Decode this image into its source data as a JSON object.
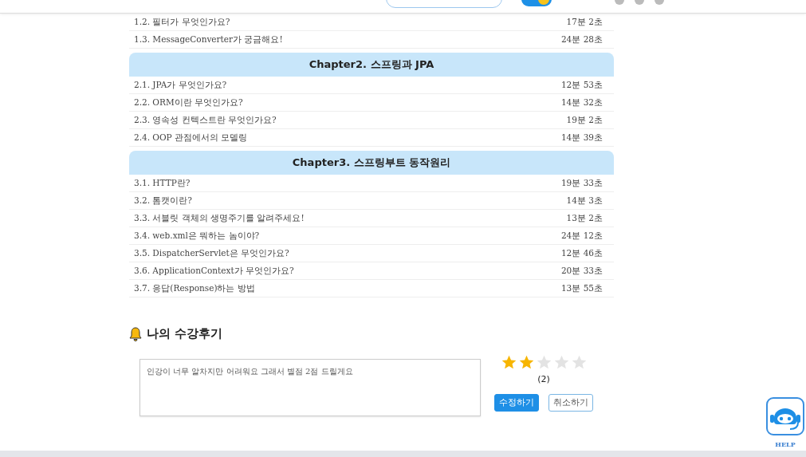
{
  "curriculum": [
    {
      "lessons": [
        {
          "title": "1.2. 필터가 무엇인가요?",
          "duration": "17분 2초"
        },
        {
          "title": "1.3. MessageConverter가 궁금해요!",
          "duration": "24분 28초"
        }
      ]
    },
    {
      "chapter": "Chapter2. 스프링과 JPA",
      "lessons": [
        {
          "title": "2.1. JPA가 무엇인가요?",
          "duration": "12분 53초"
        },
        {
          "title": "2.2. ORM이란 무엇인가요?",
          "duration": "14분 32초"
        },
        {
          "title": "2.3. 영속성 컨텍스트란 무엇인가요?",
          "duration": "19분 2초"
        },
        {
          "title": "2.4. OOP 관점에서의 모델링",
          "duration": "14분 39초"
        }
      ]
    },
    {
      "chapter": "Chapter3. 스프링부트 동작원리",
      "lessons": [
        {
          "title": "3.1. HTTP란?",
          "duration": "19분 33초"
        },
        {
          "title": "3.2. 톰캣이란?",
          "duration": "14분 3초"
        },
        {
          "title": "3.3. 서블릿 객체의 생명주기를 알려주세요!",
          "duration": "13분 2초"
        },
        {
          "title": "3.4. web.xml은 뭐하는 놈이야?",
          "duration": "24분 12초"
        },
        {
          "title": "3.5. DispatcherServlet은 무엇인가요?",
          "duration": "12분 46초"
        },
        {
          "title": "3.6. ApplicationContext가 무엇인가요?",
          "duration": "20분 33초"
        },
        {
          "title": "3.7. 응답(Response)하는 방법",
          "duration": "13분 55초"
        }
      ]
    }
  ],
  "review": {
    "title": "나의 수강후기",
    "text": "인강이 너무 알차지만 어려워요 그래서 별점 2점 드릴게요",
    "stars": 2,
    "count": "(2)",
    "buttons": [
      {
        "label": "수정하기",
        "kind": "primary"
      },
      {
        "label": "취소하기",
        "kind": "secondary"
      }
    ]
  },
  "help": {
    "label": "HELP"
  },
  "header": {
    "toggle": {
      "on": true
    }
  }
}
